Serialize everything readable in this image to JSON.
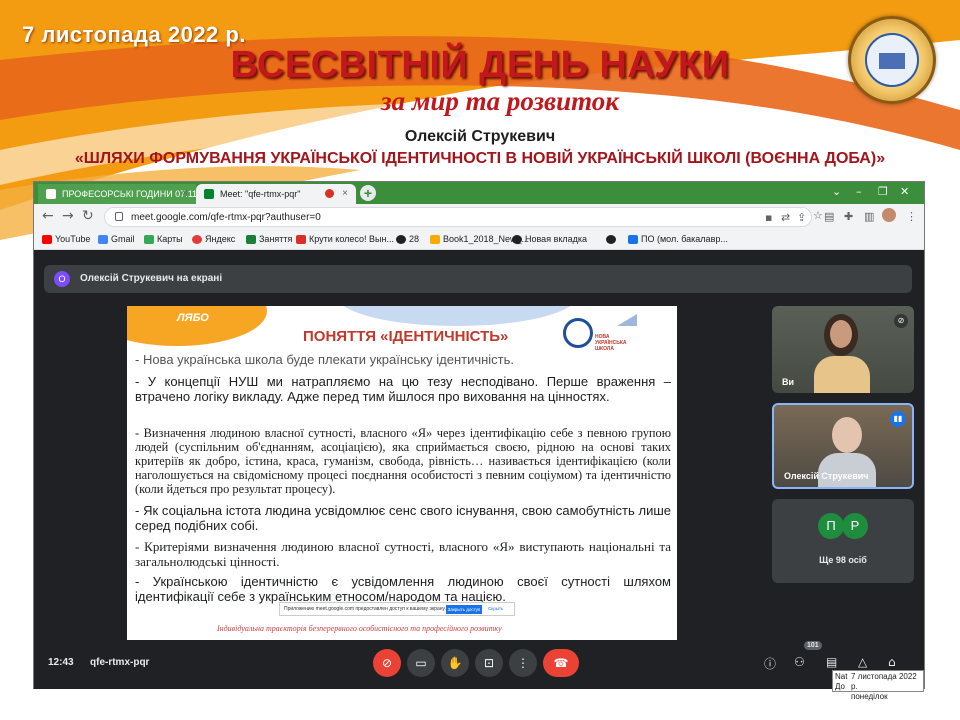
{
  "slide": {
    "date": "7 листопада 2022 р.",
    "title": "ВСЕСВІТНІЙ ДЕНЬ НАУКИ",
    "subtitle": "за мир та розвиток",
    "author": "Олексій Струкевич",
    "talk_title": "«ШЛЯХИ ФОРМУВАННЯ УКРАЇНСЬКОЇ ІДЕНТИЧНОСТІ В НОВІЙ УКРАЇНСЬКІЙ ШКОЛІ (ВОЄННА ДОБА)»",
    "colors": {
      "accent": "#c0181d",
      "orange": "#f39c12"
    }
  },
  "browser": {
    "tabs": [
      {
        "label": "ПРОФЕСОРСЬКІ ГОДИНИ 07.11...",
        "icon": "classroom-icon"
      },
      {
        "label": "Meet: \"qfe-rtmx-pqr\"",
        "icon": "meet-icon"
      }
    ],
    "url": "meet.google.com/qfe-rtmx-pqr?authuser=0",
    "bookmarks": [
      {
        "label": "YouTube",
        "icon": "youtube-icon",
        "color": "#ff0000"
      },
      {
        "label": "Gmail",
        "icon": "google-icon",
        "color": "#4285f4"
      },
      {
        "label": "Карты",
        "icon": "maps-icon",
        "color": "#34a853"
      },
      {
        "label": "Яндекс",
        "icon": "yandex-icon",
        "color": "#e53935"
      },
      {
        "label": "Заняття",
        "icon": "classroom-icon",
        "color": "#188038"
      },
      {
        "label": "Крути колесо! Вын...",
        "icon": "gift-icon",
        "color": "#d93025"
      },
      {
        "label": "28",
        "icon": "globe-icon",
        "color": "#202124"
      },
      {
        "label": "Book1_2018_New_...",
        "icon": "file-icon",
        "color": "#f9ab00"
      },
      {
        "label": "Новая вкладка",
        "icon": "globe-icon",
        "color": "#202124"
      },
      {
        "label": "",
        "icon": "globe-icon",
        "color": "#202124"
      },
      {
        "label": "ПО (мол. бакалавр...",
        "icon": "drive-icon",
        "color": "#1a73e8"
      }
    ]
  },
  "meet": {
    "presenting_banner": "Олексій Струкевич на екрані",
    "presenter_initial": "О",
    "shared_slide": {
      "heading": "ПОНЯТТЯ «ІДЕНТИЧНІСТЬ»",
      "nush_label": "НОВА УКРАЇНСЬКА ШКОЛА",
      "line1": "- Нова українська школа буде плекати українську ідентичність.",
      "line2": "- У концепції НУШ ми натрапляємо на цю тезу несподівано. Перше враження – втрачено логіку викладу. Адже перед тим йшлося про виховання на цінностях.",
      "line3": "- Визначення людиною власної сутності, власного «Я» через ідентифікацію себе з певною групою людей (суспільним об'єднанням, асоціацією), яка сприймається своєю, рідною на основі таких критеріїв як добро, істина, краса, гуманізм, свобода, рівність… називається ідентифікацією (коли наголошується на свідомісному процесі поєднання особистості з певним соціумом) та ідентичністю (коли йдеться про результат процесу).",
      "line4": "- Як соціальна істота людина усвідомлює сенс свого існування, свою самобутність лише серед подібних собі.",
      "line5": "- Критеріями визначення людиною власної сутності, власного «Я» виступають національні та загальнолюдські цінності.",
      "line6": "- Українською ідентичністю є усвідомлення людиною своєї сутності шляхом ідентифікації себе з українським етносом/народом та нацією.",
      "notification": "Приложению meet.google.com предоставлен доступ к вашему экрану.",
      "notification_button": "Закрыть доступ",
      "notification_hide": "Скрыть",
      "footer": "Індивідуальна траєкторія безперервного особистісного та професійного розвитку"
    },
    "participants": [
      {
        "name": "Ви"
      },
      {
        "name": "Олексій Струкевич"
      }
    ],
    "more_avatars": [
      "П",
      "Р"
    ],
    "more_count": "Ще 98 осіб",
    "clock": "12:43",
    "meeting_code": "qfe-rtmx-pqr",
    "participant_badge": "101"
  },
  "taskbar_tooltip": {
    "line1": "7 листопада 2022 р.",
    "line2": "понеділок",
    "left1": "Nat",
    "left2": "До"
  }
}
